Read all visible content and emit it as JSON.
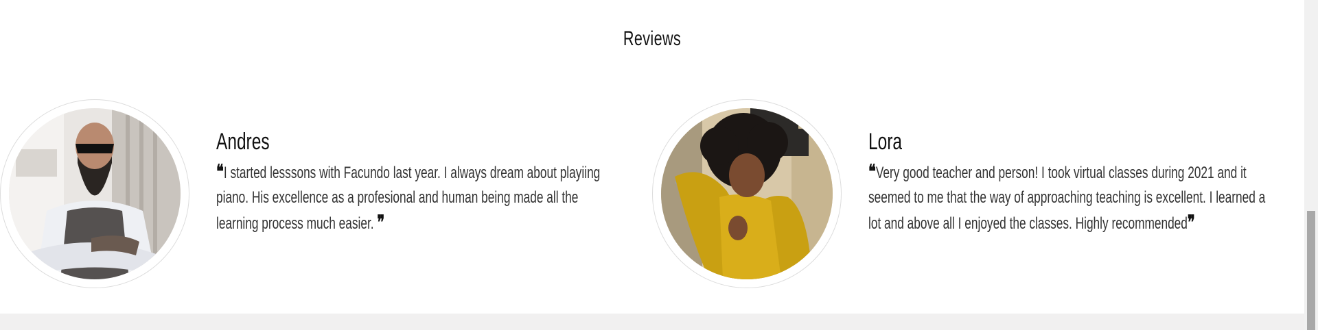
{
  "section": {
    "title": "Reviews"
  },
  "reviews": [
    {
      "name": "Andres",
      "open_quote": "❝",
      "text": "I started lesssons with Facundo last year. I always dream about playiing piano. His excellence as a profesional and human being made all the learning process much easier.",
      "close_quote": "❞",
      "avatar": "bearded-man-photo"
    },
    {
      "name": "Lora",
      "open_quote": "❝",
      "text": "Very good teacher and person! I took virtual classes during 2021 and it seemed to me that the way of approaching teaching is excellent. I learned a lot and above all I enjoyed the classes. Highly recommended",
      "close_quote": "❞",
      "avatar": "woman-yellow-hoodie-photo"
    }
  ],
  "colors": {
    "background": "#ffffff",
    "text": "#333333",
    "heading": "#111111",
    "footer_band": "#f1f0f0",
    "scrollbar_thumb": "#a8a8a8"
  }
}
